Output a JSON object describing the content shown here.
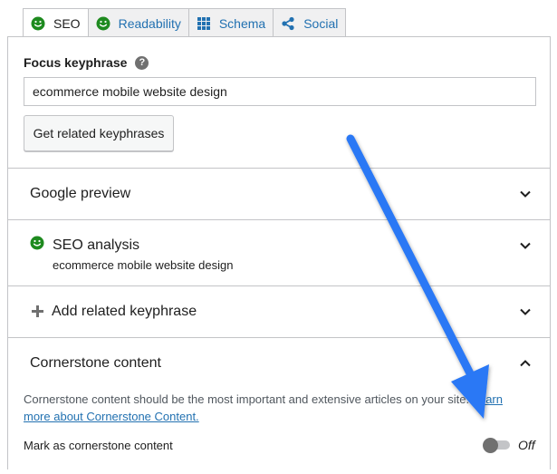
{
  "tabs": [
    {
      "label": "SEO",
      "icon": "smiley-green-icon",
      "active": true
    },
    {
      "label": "Readability",
      "icon": "smiley-green-icon",
      "active": false
    },
    {
      "label": "Schema",
      "icon": "grid-icon",
      "active": false
    },
    {
      "label": "Social",
      "icon": "share-icon",
      "active": false
    }
  ],
  "focus": {
    "label": "Focus keyphrase",
    "help": "?",
    "value": "ecommerce mobile website design",
    "related_button": "Get related keyphrases"
  },
  "sections": {
    "google_preview": {
      "title": "Google preview"
    },
    "seo_analysis": {
      "title": "SEO analysis",
      "subtitle": "ecommerce mobile website design"
    },
    "add_related": {
      "title": "Add related keyphrase",
      "icon": "plus-icon"
    },
    "cornerstone": {
      "title": "Cornerstone content",
      "description": "Cornerstone content should be the most important and extensive articles on your site.",
      "link": "Learn more about Cornerstone Content.",
      "mark_label": "Mark as cornerstone content",
      "toggle_label": "Off",
      "toggle_on": false
    }
  },
  "colors": {
    "green": "#1e8a1f",
    "link": "#2271b1",
    "border": "#c3c4c7",
    "annotation_arrow": "#2a78f5"
  }
}
